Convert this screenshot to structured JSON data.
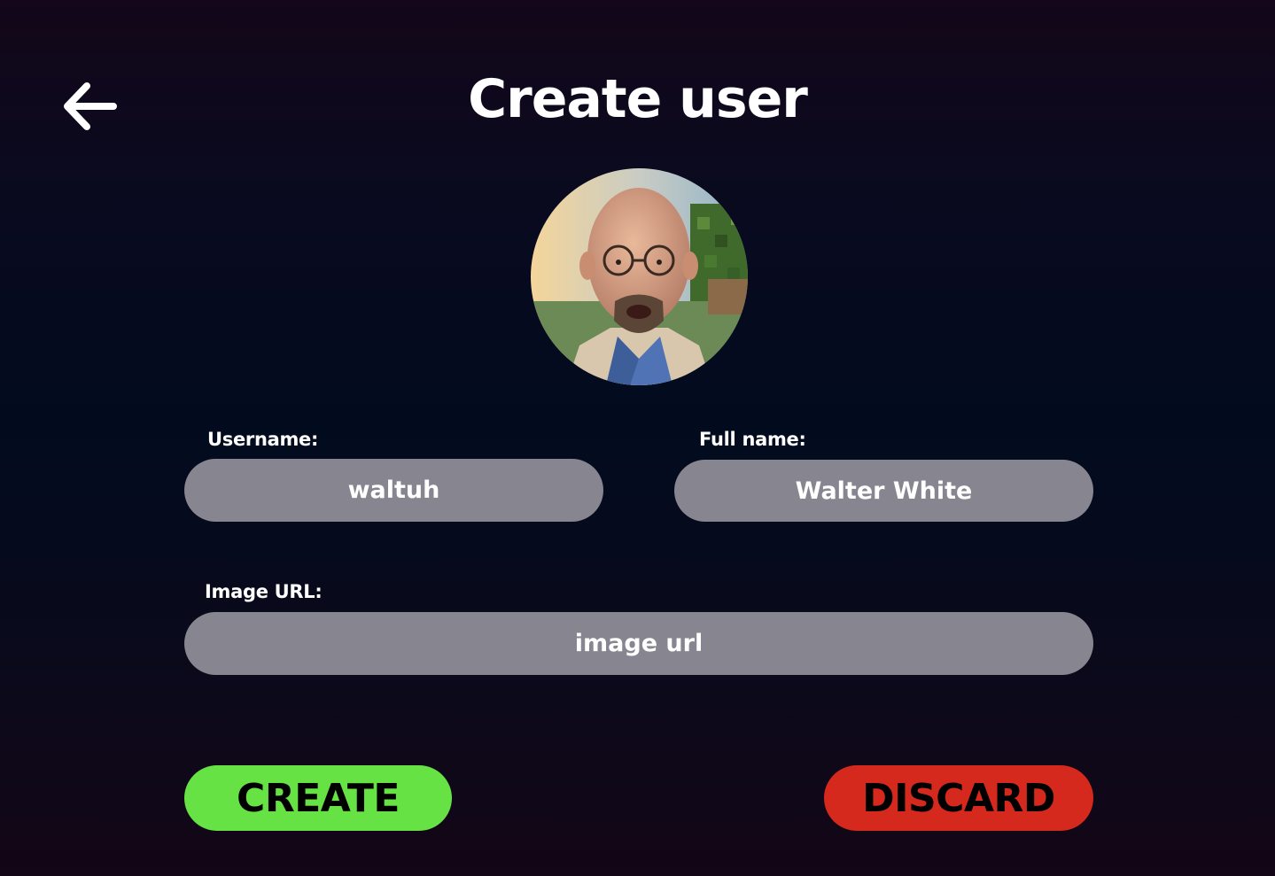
{
  "header": {
    "title": "Create user",
    "back_icon": "arrow-left-icon"
  },
  "avatar": {
    "icon": "user-avatar-photo"
  },
  "form": {
    "username": {
      "label": "Username:",
      "value": "waltuh",
      "placeholder": ""
    },
    "fullname": {
      "label": "Full name:",
      "value": "Walter White",
      "placeholder": ""
    },
    "image_url": {
      "label": "Image URL:",
      "value": "",
      "placeholder": "image url"
    }
  },
  "actions": {
    "create_label": "CREATE",
    "discard_label": "DISCARD"
  },
  "colors": {
    "create": "#67e245",
    "discard": "#d5291d",
    "input_bg": "#878690",
    "text": "#ffffff"
  }
}
